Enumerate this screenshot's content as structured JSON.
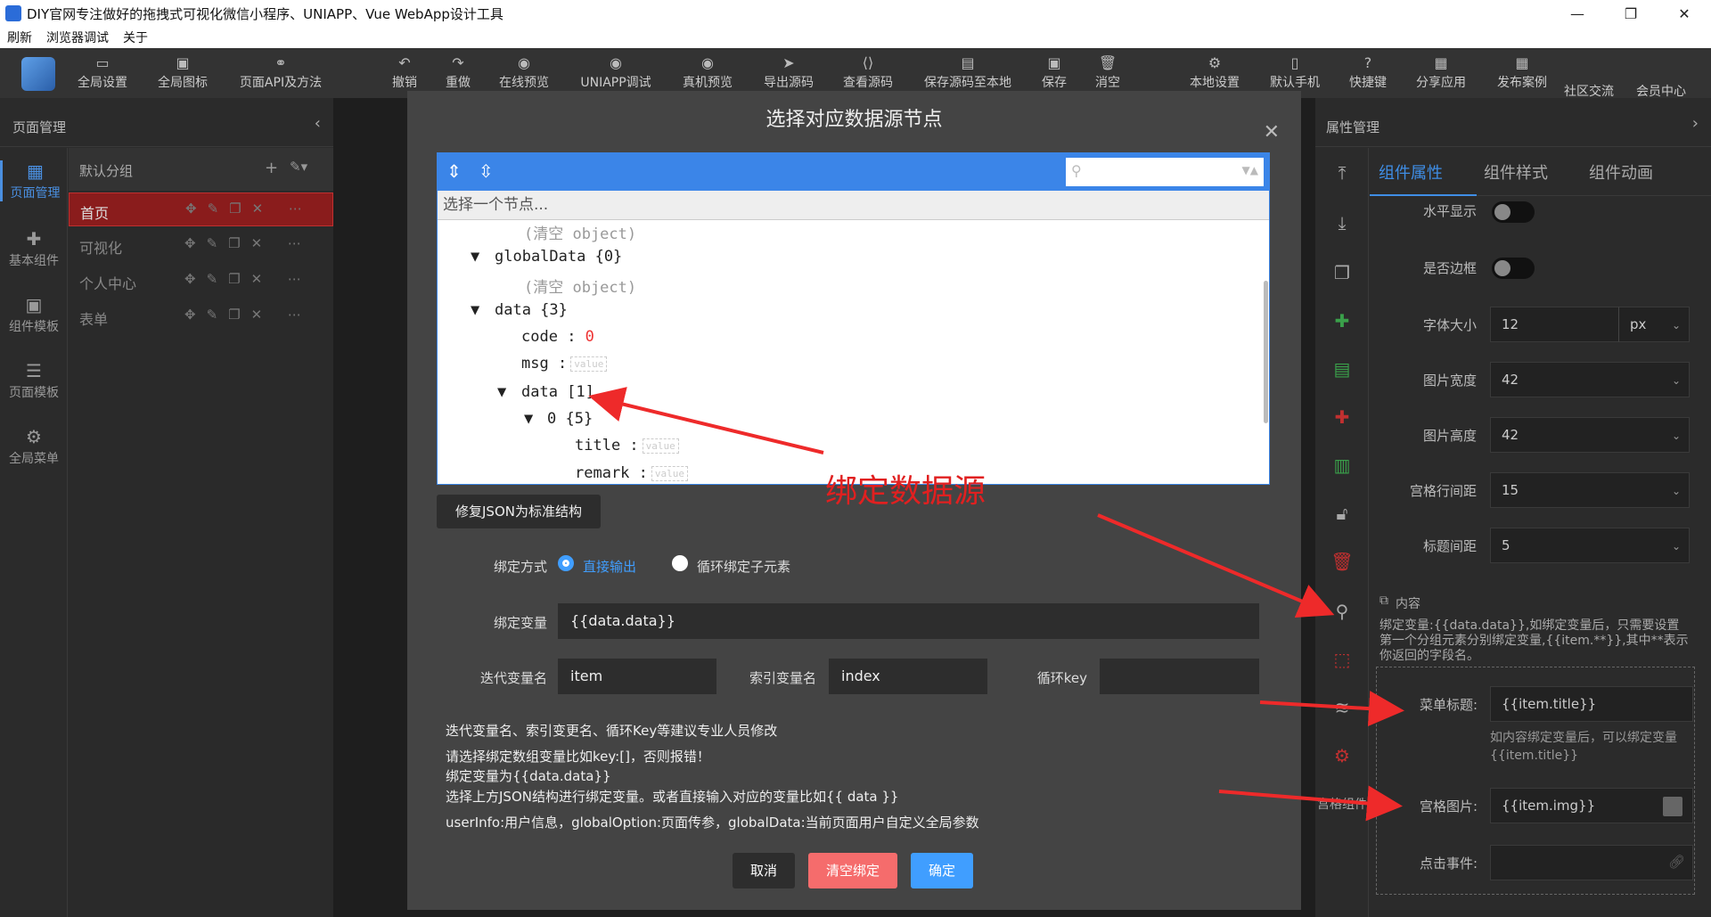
{
  "window": {
    "title": "DIY官网专注做好的拖拽式可视化微信小程序、UNIAPP、Vue WebApp设计工具",
    "minimize": "—",
    "maximize": "❐",
    "close": "✕"
  },
  "menu": [
    "刷新",
    "浏览器调试",
    "关于"
  ],
  "toolbar": {
    "left": [
      "全局设置",
      "全局图标",
      "页面API及方法"
    ],
    "center": [
      "撤销",
      "重做",
      "在线预览",
      "UNIAPP调试",
      "真机预览",
      "导出源码",
      "查看源码",
      "保存源码至本地",
      "保存",
      "消空"
    ],
    "right": [
      "本地设置",
      "默认手机",
      "快捷键",
      "分享应用",
      "发布案例",
      "社区交流",
      "会员中心"
    ]
  },
  "left_panel": {
    "title": "页面管理",
    "nav": [
      "页面管理",
      "基本组件",
      "组件模板",
      "页面模板",
      "全局菜单"
    ],
    "group": "默认分组",
    "pages": [
      "首页",
      "可视化",
      "个人中心",
      "表单"
    ]
  },
  "right_panel": {
    "title": "属性管理",
    "tabs": [
      "组件属性",
      "组件样式",
      "组件动画"
    ],
    "props": {
      "horizontal": "水平显示",
      "border": "是否边框",
      "font_size_label": "字体大小",
      "font_size": "12",
      "font_unit": "px",
      "img_width_label": "图片宽度",
      "img_width": "42",
      "img_height_label": "图片高度",
      "img_height": "42",
      "row_gap_label": "宫格行间距",
      "row_gap": "15",
      "title_gap_label": "标题间距",
      "title_gap": "5"
    },
    "content_label": "内容",
    "content_hint": "绑定变量:{{data.data}},如绑定变量后，只需要设置第一个分组元素分别绑定变量,{{item.**}},其中**表示你返回的字段名。",
    "menu_title_label": "菜单标题:",
    "menu_title_value": "{{item.title}}",
    "menu_title_hint": "如内容绑定变量后，可以绑定变量{{item.title}}",
    "grid_img_label": "宫格图片:",
    "grid_img_value": "{{item.img}}",
    "click_event_label": "点击事件:",
    "grid_component": "宫格组件"
  },
  "modal": {
    "title": "选择对应数据源节点",
    "select_placeholder": "选择一个节点...",
    "tree": {
      "empty_obj": "(清空 object)",
      "globalData": "globalData {0}",
      "empty_obj2": "(清空 object)",
      "data": "data {3}",
      "code_key": "code",
      "code_val": "0",
      "msg_key": "msg",
      "data_arr": "data [1]",
      "item0": "0 {5}",
      "title_key": "title",
      "remark_key": "remark",
      "value_tag": "value"
    },
    "fix_json": "修复JSON为标准结构",
    "bind_mode_label": "绑定方式",
    "bind_mode_direct": "直接输出",
    "bind_mode_loop": "循环绑定子元素",
    "bind_var_label": "绑定变量",
    "bind_var_value": "{{data.data}}",
    "iter_label": "迭代变量名",
    "iter_value": "item",
    "index_label": "索引变量名",
    "index_value": "index",
    "loop_key_label": "循环key",
    "loop_key_value": "",
    "notes": [
      "迭代变量名、索引变更名、循环Key等建议专业人员修改",
      "请选择绑定数组变量比如key:[]，否则报错！",
      "绑定变量为{{data.data}}",
      "选择上方JSON结构进行绑定变量。或者直接输入对应的变量比如{{ data }}",
      "userInfo:用户信息，globalOption:页面传参，globalData:当前页面用户自定义全局参数"
    ],
    "cancel": "取消",
    "clear_bind": "清空绑定",
    "confirm": "确定",
    "colors": {
      "primary": "#409eff",
      "danger": "#f56c6c"
    }
  },
  "annotation": "绑定数据源"
}
